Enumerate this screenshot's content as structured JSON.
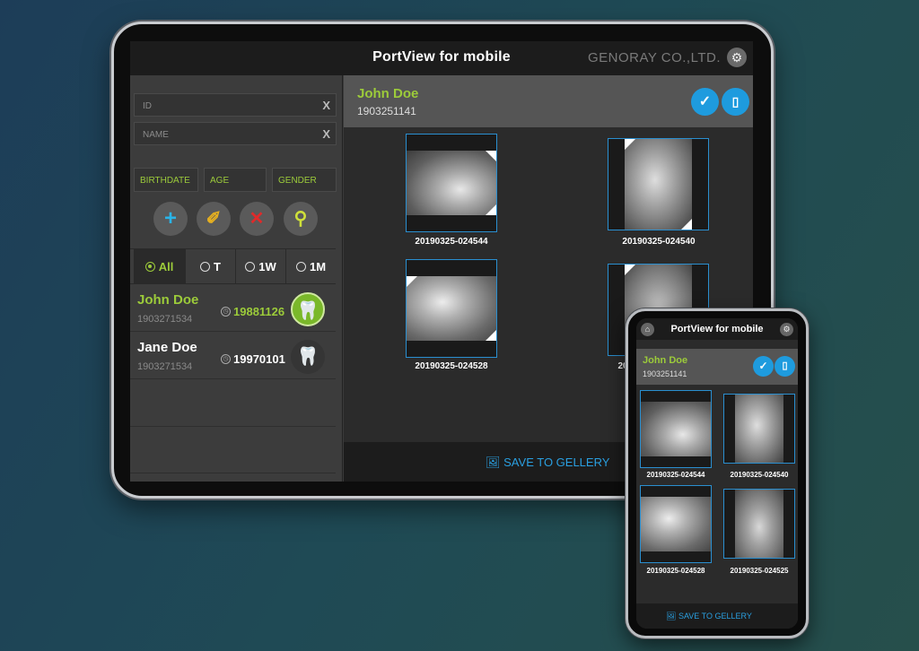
{
  "tablet": {
    "app_title": "PortView for mobile",
    "company": "GENORAY CO.,LTD.",
    "search": {
      "id_placeholder": "ID",
      "name_placeholder": "NAME",
      "clear_glyph": "X",
      "birthdate_label": "BIRTHDATE",
      "age_label": "AGE",
      "gender_label": "GENDER"
    },
    "actions": [
      {
        "name": "add-icon",
        "glyph": "+",
        "color": "#2ab4e8"
      },
      {
        "name": "edit-icon",
        "glyph": "✐",
        "color": "#e6b020"
      },
      {
        "name": "delete-icon",
        "glyph": "✕",
        "color": "#e02a2a"
      },
      {
        "name": "search-icon",
        "glyph": "⚲",
        "color": "#cfe03a"
      }
    ],
    "filters": [
      {
        "label": "All",
        "active": true
      },
      {
        "label": "T",
        "active": false
      },
      {
        "label": "1W",
        "active": false
      },
      {
        "label": "1M",
        "active": false
      }
    ],
    "patients": [
      {
        "name": "John Doe",
        "id": "1903271534",
        "date": "19881126",
        "selected": true
      },
      {
        "name": "Jane Doe",
        "id": "1903271534",
        "date": "19970101",
        "selected": false
      }
    ],
    "header": {
      "name": "John Doe",
      "id": "1903251141"
    },
    "images": [
      "20190325-024544",
      "20190325-024540",
      "20190325-024528",
      "20190325-024525"
    ],
    "visible_image_labels": {
      "fourth_truncated": "20"
    },
    "save_label": "SAVE TO GELLERY"
  },
  "phone": {
    "app_title": "PortView for mobile",
    "header": {
      "name": "John Doe",
      "id": "1903251141"
    },
    "images": [
      "20190325-024544",
      "20190325-024540",
      "20190325-024528",
      "20190325-024525"
    ],
    "save_label": "SAVE TO GELLERY"
  },
  "colors": {
    "accent_green": "#9ccb3a",
    "accent_blue": "#1e9bde",
    "background": "#1f4a55"
  }
}
